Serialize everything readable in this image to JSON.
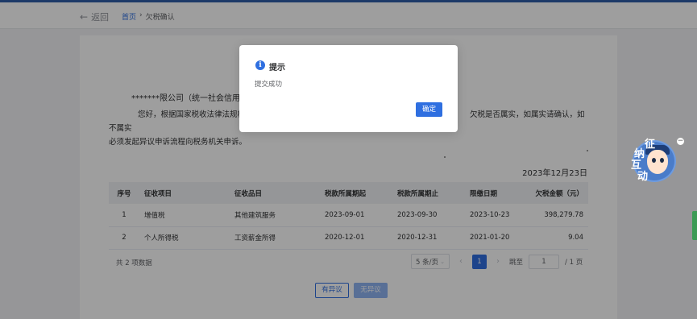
{
  "nav": {
    "back_label": "返回",
    "breadcrumb": {
      "home": "首页",
      "separator": "›",
      "current": "欠税确认"
    }
  },
  "content": {
    "company_line": "*******限公司（统一社会信用代码",
    "notice_start": "您好，根据国家税收法律法规相关规",
    "notice_end": "欠税是否属实，如属实请确认，如不属实",
    "notice_line2": "必须发起异议申诉流程向税务机关申诉。",
    "date": "2023年12月23日"
  },
  "table": {
    "headers": [
      "序号",
      "征收项目",
      "征收品目",
      "税款所属期起",
      "税款所属期止",
      "限缴日期",
      "欠税金额（元）"
    ],
    "rows": [
      [
        "1",
        "增值税",
        "其他建筑服务",
        "2023-09-01",
        "2023-09-30",
        "2023-10-23",
        "398,279.78"
      ],
      [
        "2",
        "个人所得税",
        "工资薪金所得",
        "2020-12-01",
        "2020-12-31",
        "2021-01-20",
        "9.04"
      ]
    ]
  },
  "pagination": {
    "total": "共 2 项数据",
    "page_size": "5 条/页",
    "current_page": "1",
    "jump_label": "跳至",
    "jump_value": "1",
    "page_total": "/ 1 页"
  },
  "actions": {
    "dispute": "有异议",
    "no_dispute": "无异议"
  },
  "assistant": {
    "chars": [
      "纳",
      "征",
      "互",
      "动"
    ],
    "close": "−"
  },
  "dialog": {
    "icon": "i",
    "title": "提示",
    "message": "提交成功",
    "ok": "确定"
  },
  "colors": {
    "primary": "#2f6fe0",
    "topbar": "#2f5ea8"
  }
}
